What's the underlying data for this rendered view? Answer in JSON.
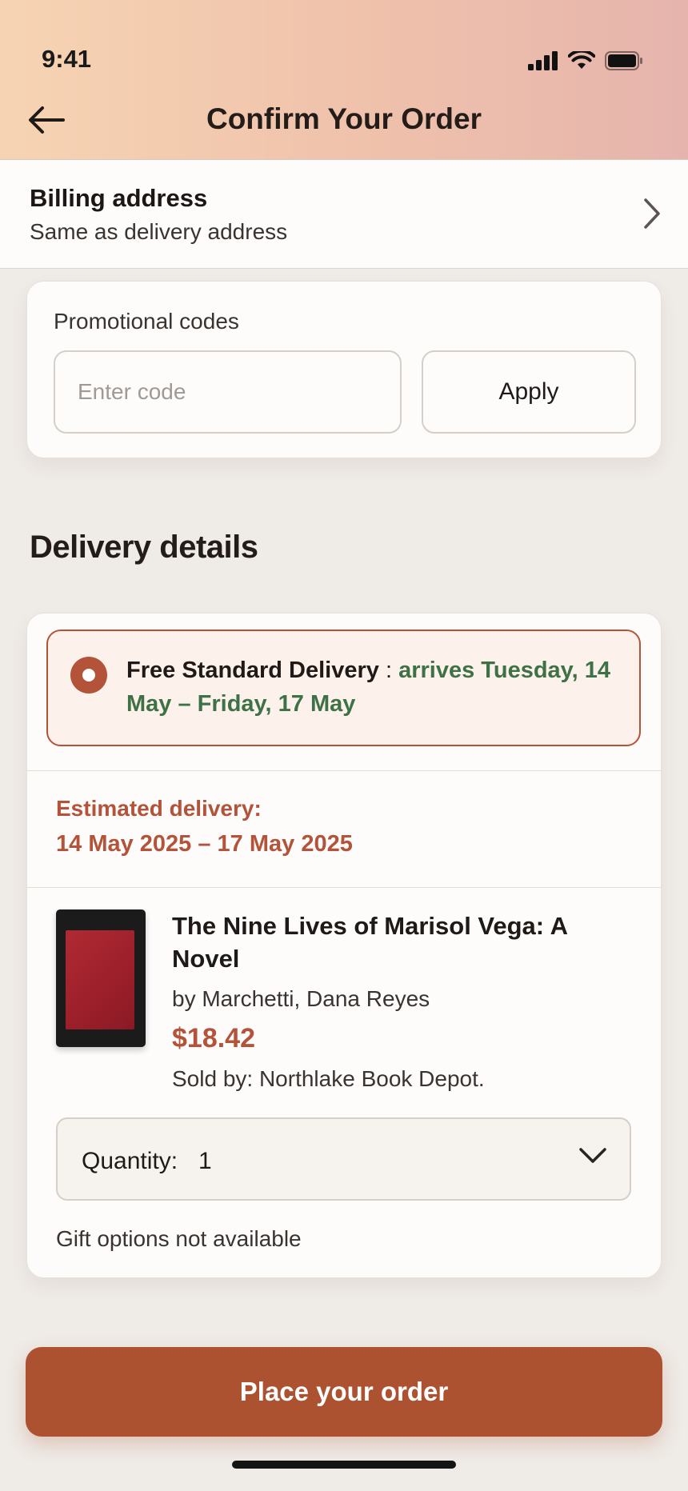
{
  "status_bar": {
    "time": "9:41"
  },
  "header": {
    "title": "Confirm Your Order"
  },
  "billing": {
    "title": "Billing address",
    "subtitle": "Same as delivery address"
  },
  "promo": {
    "label": "Promotional codes",
    "placeholder": "Enter code",
    "value": "",
    "apply_label": "Apply"
  },
  "delivery": {
    "section_title": "Delivery details",
    "option": {
      "name": "Free Standard Delivery",
      "separator": " : ",
      "arrival": "arrives Tuesday, 14 May – Friday, 17 May",
      "selected": true
    },
    "estimated_label": "Estimated delivery:",
    "estimated_range": "14 May 2025 – 17 May 2025",
    "item": {
      "title": "The Nine Lives of Marisol Vega: A Novel",
      "author": "by Marchetti, Dana Reyes",
      "price": "$18.42",
      "seller": "Sold by: Northlake Book Depot."
    },
    "quantity": {
      "label": "Quantity:",
      "value": "1"
    },
    "gift_note": "Gift options not available"
  },
  "footer": {
    "place_order_label": "Place your order"
  },
  "colors": {
    "accent": "#ad5230",
    "arrival_green": "#3e7246",
    "background": "#efebe7"
  },
  "icons": [
    "signal-icon",
    "wifi-icon",
    "battery-icon",
    "back-arrow-icon",
    "chevron-right-icon",
    "chevron-down-icon",
    "radio-selected-icon"
  ]
}
